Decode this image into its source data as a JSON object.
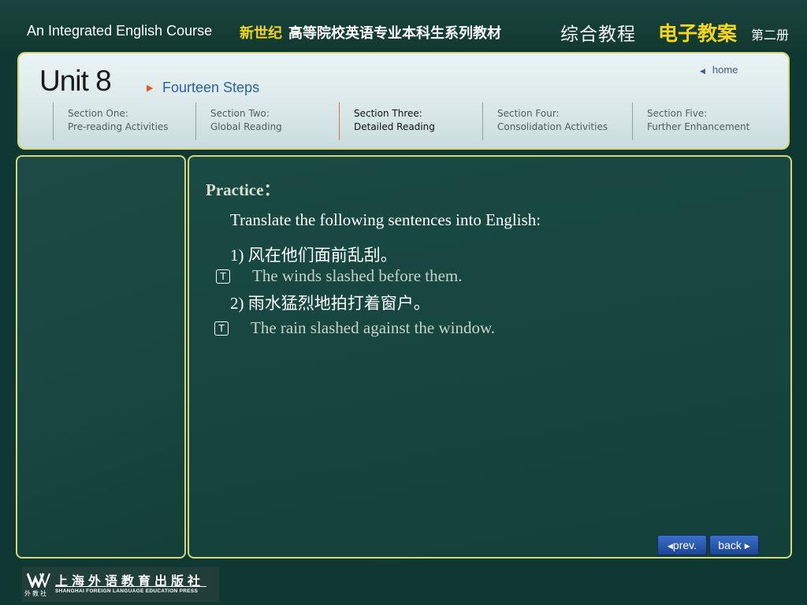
{
  "top_banner": {
    "course_en": "An Integrated English Course",
    "course_cn_new": "新世纪",
    "course_cn_series": "高等院校英语专业本科生系列教材",
    "book_cn": "综合教程",
    "edition_cn": "电子教案",
    "volume_cn": "第二册",
    "accent_color": "#f5d617"
  },
  "header": {
    "unit_title": "Unit 8",
    "subtitle": "Fourteen Steps",
    "home_label": "home",
    "sections": [
      {
        "line1": "Section One:",
        "line2": "Pre-reading Activities",
        "active": false
      },
      {
        "line1": "Section Two:",
        "line2": "Global Reading",
        "active": false
      },
      {
        "line1": "Section Three:",
        "line2": "Detailed Reading",
        "active": true
      },
      {
        "line1": "Section Four:",
        "line2": "Consolidation Activities",
        "active": false
      },
      {
        "line1": "Section Five:",
        "line2": "Further Enhancement",
        "active": false
      }
    ]
  },
  "content": {
    "heading": "Practice：",
    "instruction": "Translate the following sentences into English:",
    "items": [
      {
        "chinese": "1) 风在他们面前乱刮。",
        "icon": "t-icon",
        "answer": "The winds slashed before them."
      },
      {
        "chinese": "2) 雨水猛烈地拍打着窗户。",
        "icon": "t-icon",
        "answer": "The rain slashed against the window."
      }
    ]
  },
  "nav": {
    "prev_label": "prev.",
    "back_label": "back"
  },
  "footer": {
    "publisher_cn": "上海外语教育出版社",
    "publisher_en": "SHANGHAI FOREIGN LANGUAGE EDUCATION PRESS",
    "logo_sub": "外教社"
  }
}
